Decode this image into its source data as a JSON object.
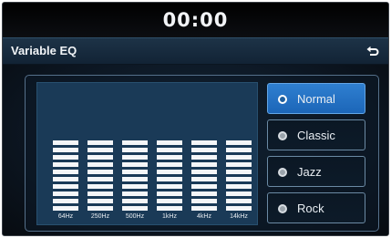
{
  "status": {
    "clock": "00:00"
  },
  "header": {
    "title": "Variable EQ",
    "back_icon": "back-arrow-icon"
  },
  "equalizer": {
    "bands": [
      {
        "label": "64Hz",
        "level": 10
      },
      {
        "label": "250Hz",
        "level": 10
      },
      {
        "label": "500Hz",
        "level": 10
      },
      {
        "label": "1kHz",
        "level": 10
      },
      {
        "label": "4kHz",
        "level": 10
      },
      {
        "label": "14kHz",
        "level": 10
      }
    ]
  },
  "presets": [
    {
      "label": "Normal",
      "selected": true
    },
    {
      "label": "Classic",
      "selected": false
    },
    {
      "label": "Jazz",
      "selected": false
    },
    {
      "label": "Rock",
      "selected": false
    }
  ],
  "colors": {
    "accent": "#2a7ad0",
    "eq_panel": "#1a3a57",
    "header": "#1a2f43"
  }
}
